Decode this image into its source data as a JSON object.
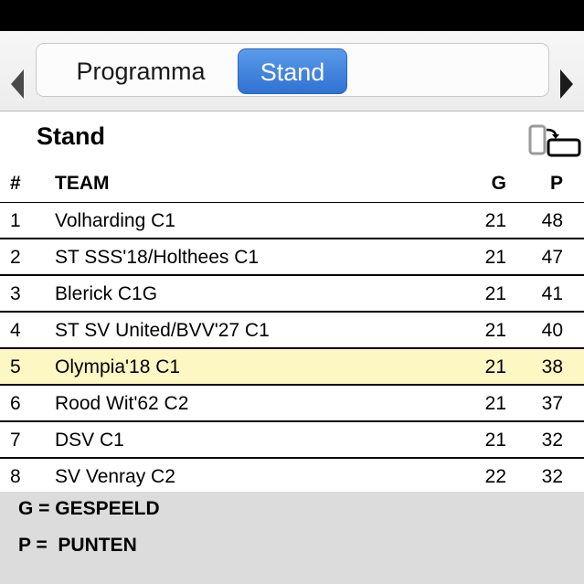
{
  "tabs": {
    "programma_label": "Programma",
    "stand_label": "Stand",
    "selected": "Stand"
  },
  "page": {
    "title": "Stand"
  },
  "table": {
    "headers": {
      "rank": "#",
      "team": "TEAM",
      "g": "G",
      "p": "P"
    },
    "rows": [
      {
        "rank": "1",
        "team": "Volharding C1",
        "g": "21",
        "p": "48"
      },
      {
        "rank": "2",
        "team": "ST SSS'18/Holthees C1",
        "g": "21",
        "p": "47"
      },
      {
        "rank": "3",
        "team": "Blerick C1G",
        "g": "21",
        "p": "41"
      },
      {
        "rank": "4",
        "team": "ST SV United/BVV'27 C1",
        "g": "21",
        "p": "40"
      },
      {
        "rank": "5",
        "team": "Olympia'18 C1",
        "g": "21",
        "p": "38"
      },
      {
        "rank": "6",
        "team": "Rood Wit'62 C2",
        "g": "21",
        "p": "37"
      },
      {
        "rank": "7",
        "team": "DSV C1",
        "g": "21",
        "p": "32"
      },
      {
        "rank": "8",
        "team": "SV Venray C2",
        "g": "22",
        "p": "32"
      }
    ],
    "highlight_color": "#fdf7c4"
  },
  "legend": {
    "g_line": "G = GESPEELD",
    "p_line": "P =  PUNTEN"
  },
  "colors": {
    "accent": "#2f72d2",
    "status_bar": "#000000",
    "legend_bg": "#dcdcdc"
  },
  "icons": {
    "left": "chevron-left-icon",
    "right": "chevron-right-icon",
    "rotate": "rotate-device-icon"
  }
}
